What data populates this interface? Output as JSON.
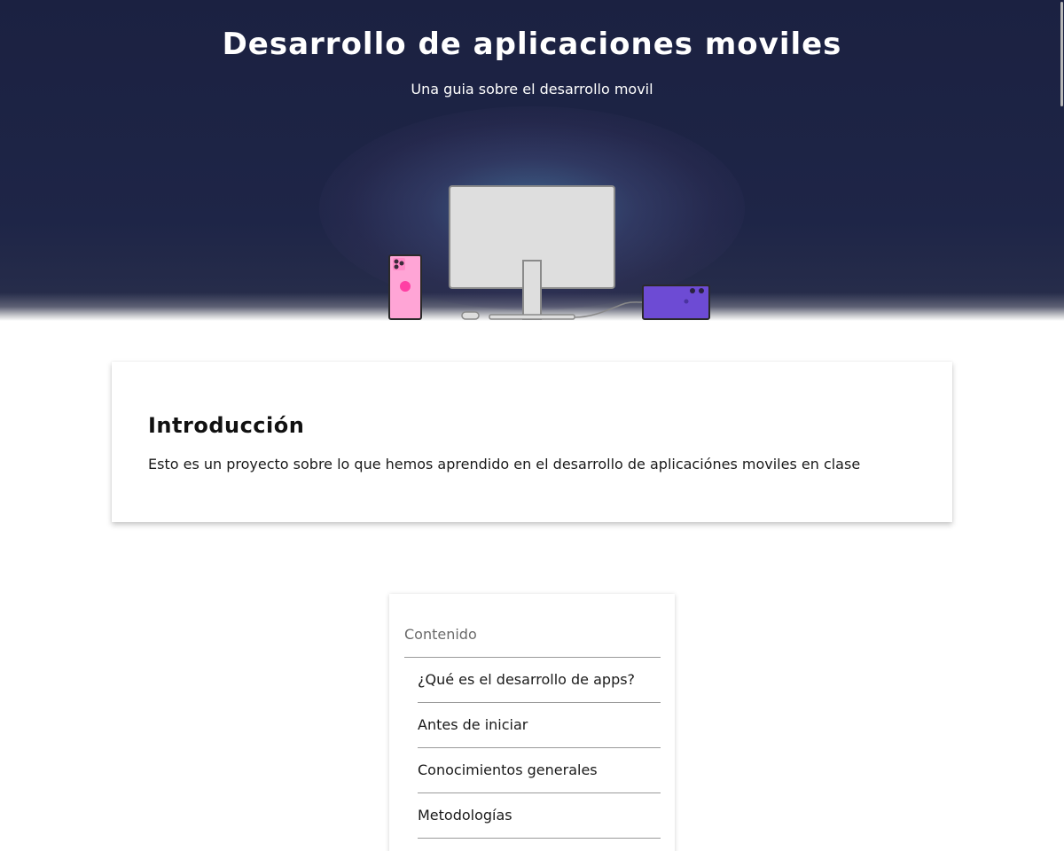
{
  "header": {
    "title": "Desarrollo de aplicaciones moviles",
    "subtitle": "Una guia sobre el desarrollo movil"
  },
  "hero_illustration": {
    "description_icons": [
      "phone-icon",
      "monitor-icon",
      "mouse-icon",
      "tablet-icon"
    ],
    "colors": {
      "background": "#1b2141",
      "phone": "#ffa5d6",
      "phone_accent": "#ff3fa4",
      "monitor": "#dedede",
      "tablet": "#6d4bd4"
    }
  },
  "intro": {
    "title": "Introducción",
    "text": "Esto es un proyecto sobre lo que hemos aprendido en el desarrollo de aplicaciónes moviles en clase"
  },
  "toc": {
    "heading": "Contenido",
    "items": [
      {
        "label": "¿Qué es el desarrollo de apps?"
      },
      {
        "label": "Antes de iniciar"
      },
      {
        "label": "Conocimientos generales"
      },
      {
        "label": "Metodologías"
      },
      {
        "label": ""
      }
    ]
  }
}
